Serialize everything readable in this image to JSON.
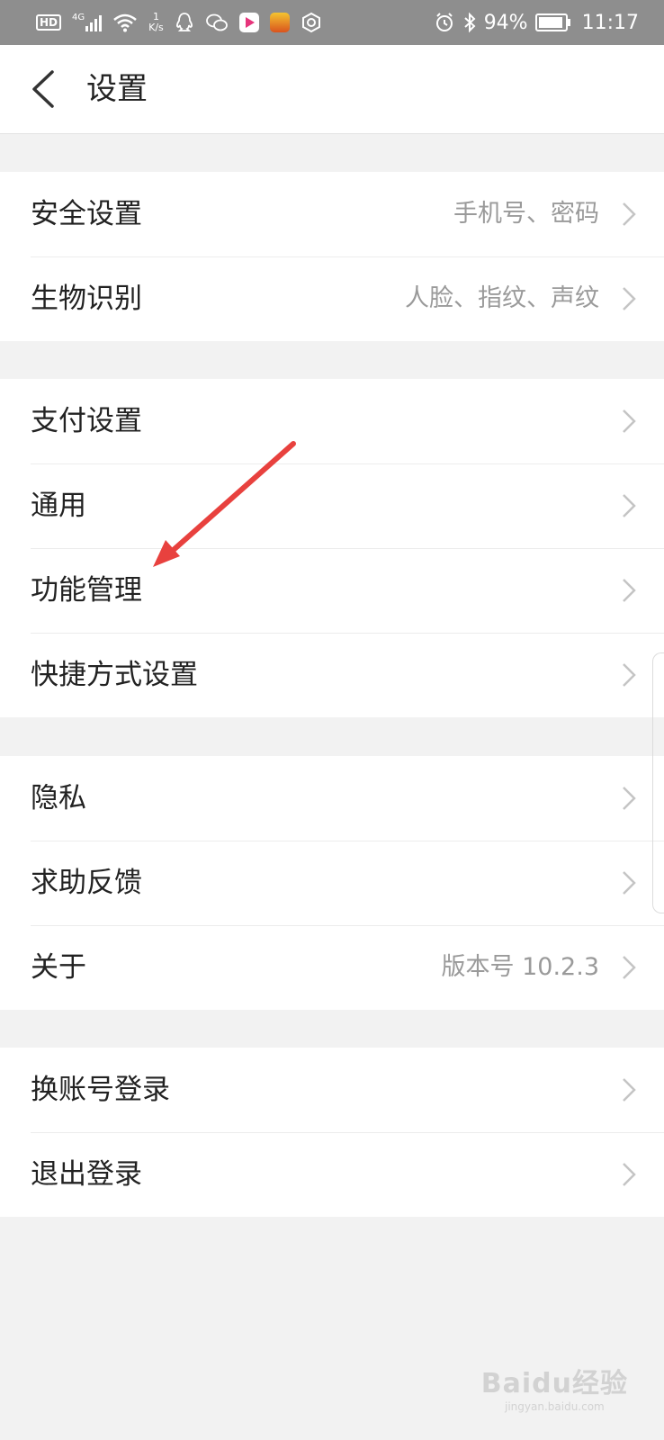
{
  "status_bar": {
    "hd_badge": "HD",
    "network": "4G",
    "speed_value": "1",
    "speed_unit": "K/s",
    "battery_percent": "94%",
    "battery_level": 0.94,
    "time": "11:17",
    "left_icons": [
      "hd-icon",
      "signal-icon",
      "wifi-icon",
      "qq-icon",
      "wechat-icon",
      "video-app-icon",
      "game-app-icon",
      "settings-app-icon"
    ],
    "right_icons": [
      "alarm-icon",
      "bluetooth-icon",
      "battery-icon"
    ]
  },
  "header": {
    "title": "设置",
    "back_icon": "back-chevron-icon"
  },
  "groups": [
    {
      "items": [
        {
          "label": "安全设置",
          "value": "手机号、密码"
        },
        {
          "label": "生物识别",
          "value": "人脸、指纹、声纹"
        }
      ]
    },
    {
      "items": [
        {
          "label": "支付设置",
          "value": ""
        },
        {
          "label": "通用",
          "value": ""
        },
        {
          "label": "功能管理",
          "value": ""
        },
        {
          "label": "快捷方式设置",
          "value": ""
        }
      ]
    },
    {
      "items": [
        {
          "label": "隐私",
          "value": ""
        },
        {
          "label": "求助反馈",
          "value": ""
        },
        {
          "label": "关于",
          "value": "版本号 10.2.3"
        }
      ]
    },
    {
      "items": [
        {
          "label": "换账号登录",
          "value": ""
        },
        {
          "label": "退出登录",
          "value": ""
        }
      ]
    }
  ],
  "colors": {
    "status_bar_bg": "#8e8e8e",
    "page_bg": "#f2f2f2",
    "row_bg": "#ffffff",
    "label_text": "#222222",
    "value_text": "#9a9a9a",
    "chevron": "#c4c4c4",
    "annotation_arrow": "#e8413e"
  },
  "watermark": {
    "main": "Baidu经验",
    "sub": "jingyan.baidu.com"
  }
}
